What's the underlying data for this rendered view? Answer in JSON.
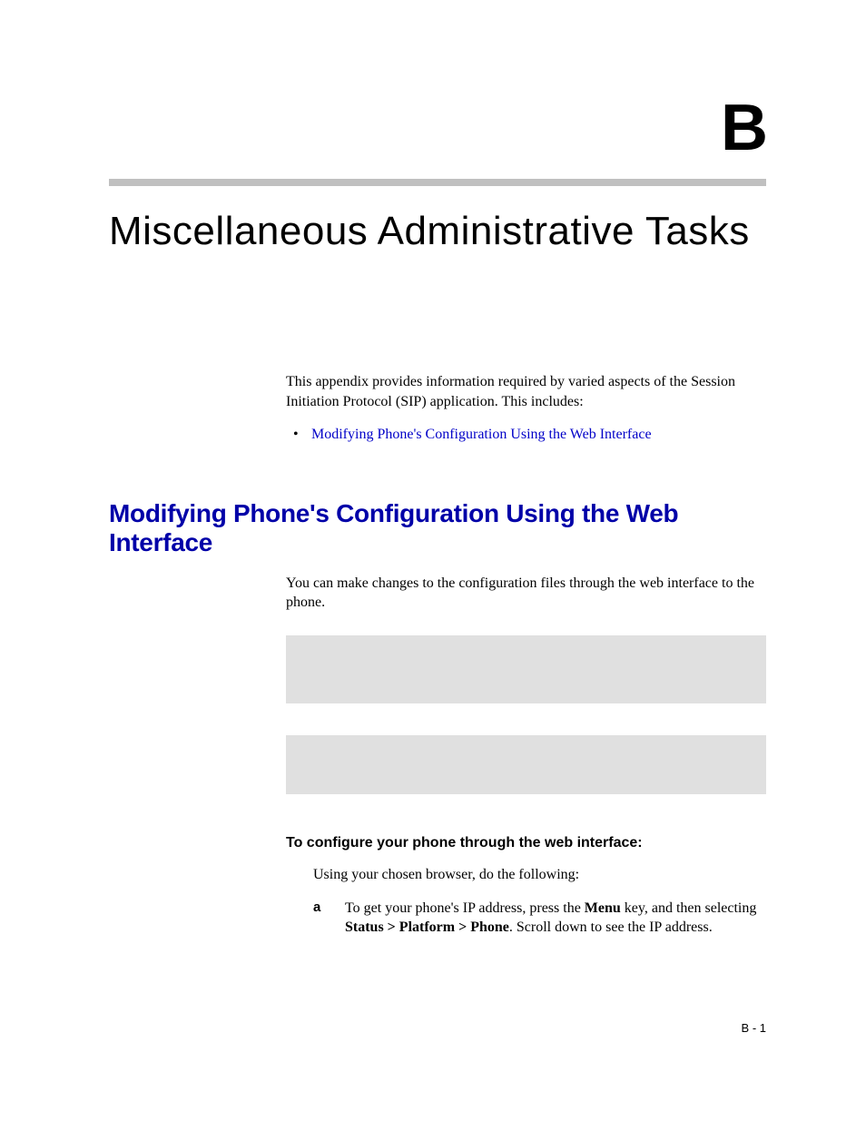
{
  "appendix": {
    "letter": "B",
    "title": "Miscellaneous Administrative Tasks"
  },
  "intro": {
    "paragraph": "This appendix provides information required by varied aspects of the Session Initiation Protocol (SIP) application. This includes:",
    "bullet_link": "Modifying Phone's Configuration Using the Web Interface"
  },
  "section": {
    "heading": "Modifying Phone's Configuration Using the Web Interface",
    "intro_para": "You can make changes to the configuration files through the web interface to the phone.",
    "subheading": "To configure your phone through the web interface:",
    "sub_para": "Using your chosen browser, do the following:",
    "step_a": {
      "letter": "a",
      "text_before_menu": "To get your phone's IP address, press the ",
      "menu_bold": "Menu",
      "text_mid": " key, and then selecting ",
      "path_bold": "Status > Platform > Phone",
      "text_after": ". Scroll down to see the IP address."
    }
  },
  "footer": {
    "page_number": "B - 1"
  }
}
